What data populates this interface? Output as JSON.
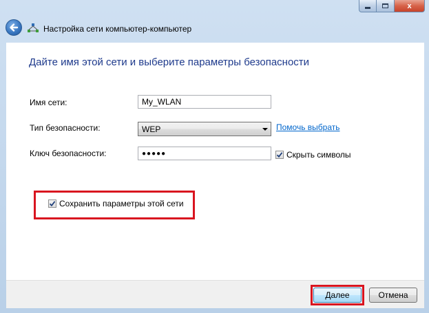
{
  "window": {
    "title": "Настройка сети компьютер-компьютер",
    "close_glyph": "x"
  },
  "icons": {
    "back": "back-arrow-icon",
    "network": "network-adhoc-icon",
    "minimize": "minimize-icon",
    "maximize": "maximize-icon",
    "close": "close-icon",
    "check": "checkmark-icon"
  },
  "content": {
    "heading": "Дайте имя этой сети и выберите параметры безопасности",
    "network_name": {
      "label": "Имя сети:",
      "value": "My_WLAN"
    },
    "security_type": {
      "label": "Тип безопасности:",
      "selected": "WEP",
      "help_link": "Помочь выбрать"
    },
    "security_key": {
      "label": "Ключ безопасности:",
      "value": "●●●●●",
      "hide_chars_label": "Скрыть символы",
      "hide_chars_checked": true
    },
    "save_settings": {
      "label": "Сохранить параметры этой сети",
      "checked": true
    }
  },
  "footer": {
    "next_label": "Далее",
    "cancel_label": "Отмена"
  },
  "colors": {
    "heading": "#1e3a8c",
    "link": "#0066cc",
    "highlight": "#d9141f"
  }
}
